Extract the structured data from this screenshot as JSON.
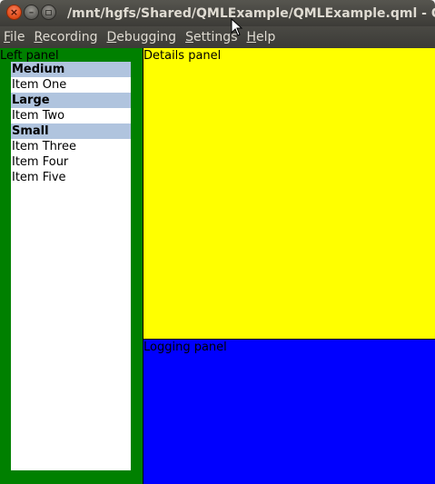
{
  "window": {
    "title": "/mnt/hgfs/Shared/QMLExample/QMLExample.qml - Q"
  },
  "menubar": {
    "items": [
      {
        "mnemonic": "F",
        "rest": "ile"
      },
      {
        "mnemonic": "R",
        "rest": "ecording"
      },
      {
        "mnemonic": "D",
        "rest": "ebugging"
      },
      {
        "mnemonic": "S",
        "rest": "ettings"
      },
      {
        "mnemonic": "H",
        "rest": "elp"
      }
    ]
  },
  "left_panel": {
    "label": "Left panel",
    "list": [
      {
        "text": "Medium",
        "type": "section"
      },
      {
        "text": "Item One",
        "type": "item"
      },
      {
        "text": "Large",
        "type": "section"
      },
      {
        "text": "Item Two",
        "type": "item"
      },
      {
        "text": "Small",
        "type": "section"
      },
      {
        "text": "Item Three",
        "type": "item"
      },
      {
        "text": "Item Four",
        "type": "item"
      },
      {
        "text": "Item Five",
        "type": "item"
      }
    ]
  },
  "details_panel": {
    "label": "Details panel"
  },
  "logging_panel": {
    "label": "Logging panel"
  },
  "colors": {
    "left_panel_bg": "#008000",
    "details_panel_bg": "#ffff00",
    "logging_panel_bg": "#0000ff",
    "section_bg": "#b0c4de"
  },
  "icons": {
    "close": "close-icon",
    "minimize": "minimize-icon",
    "maximize": "maximize-icon",
    "cursor": "mouse-pointer-icon"
  }
}
